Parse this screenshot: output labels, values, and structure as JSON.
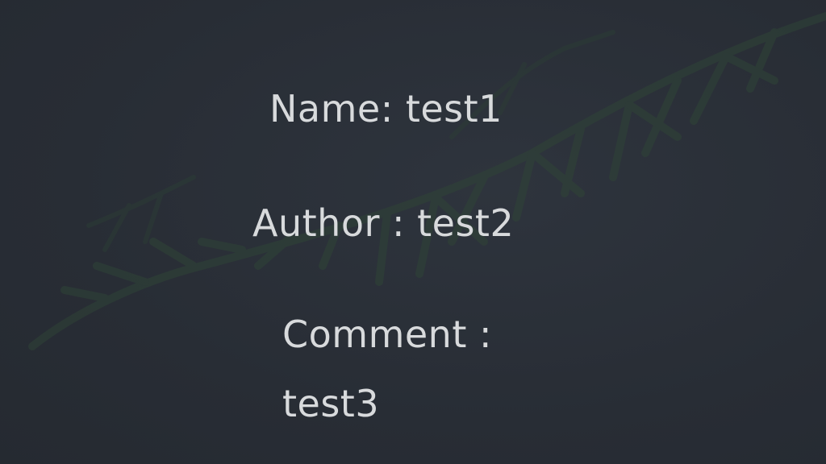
{
  "details": {
    "name_line": "Name: test1",
    "author_line": "Author : test2",
    "comment_label": "Comment :",
    "comment_value": "test3"
  },
  "colors": {
    "background": "#2a2f38",
    "text": "#d8dadc",
    "foliage": "#2f4a3a"
  }
}
